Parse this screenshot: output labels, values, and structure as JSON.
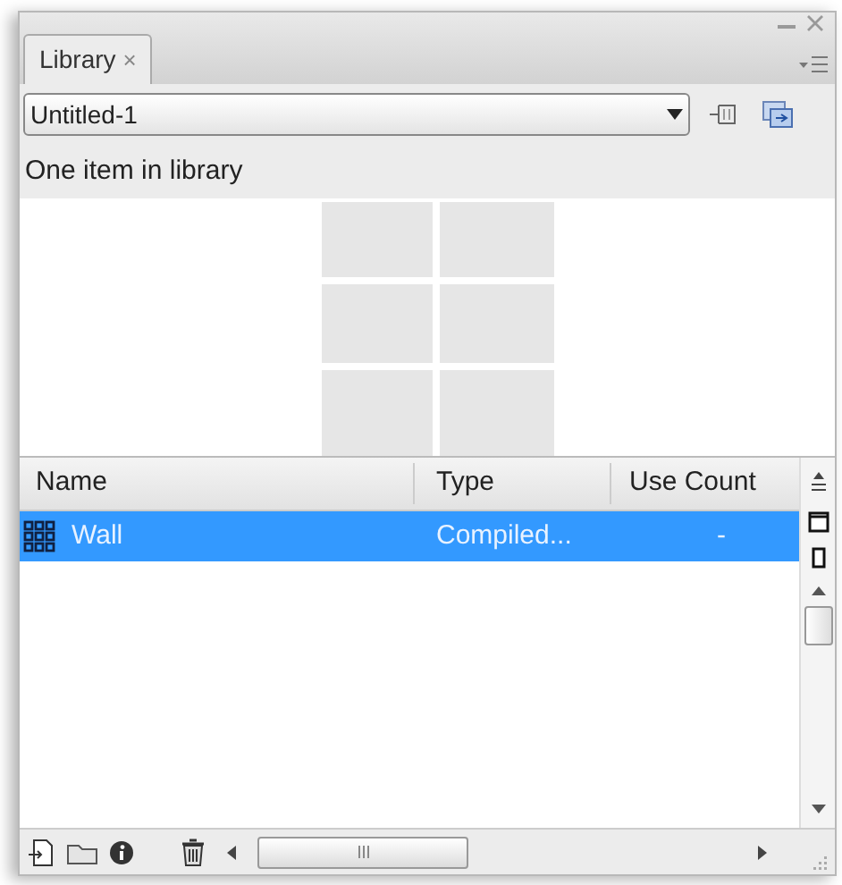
{
  "tab": {
    "label": "Library",
    "close": "×",
    "selected": true
  },
  "document": {
    "value": "Untitled-1"
  },
  "status": "One item in library",
  "table": {
    "columns": [
      "Name",
      "Type",
      "Use Count"
    ],
    "rows": [
      {
        "name": "Wall",
        "type": "Compiled...",
        "use_count": "-",
        "selected": true
      }
    ]
  }
}
